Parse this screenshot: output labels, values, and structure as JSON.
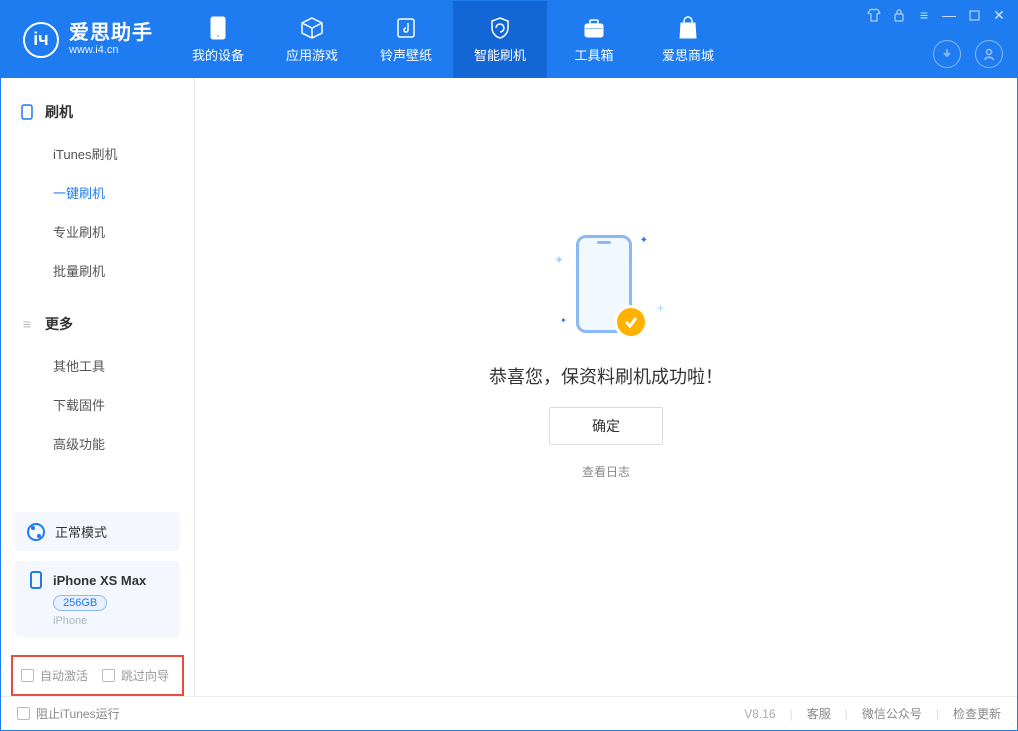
{
  "app": {
    "name": "爱思助手",
    "url": "www.i4.cn"
  },
  "nav": {
    "device": "我的设备",
    "apps": "应用游戏",
    "ringtones": "铃声壁纸",
    "flash": "智能刷机",
    "toolbox": "工具箱",
    "store": "爱思商城"
  },
  "sidebar": {
    "section_flash": "刷机",
    "items_flash": {
      "itunes": "iTunes刷机",
      "oneclick": "一键刷机",
      "pro": "专业刷机",
      "batch": "批量刷机"
    },
    "section_more": "更多",
    "items_more": {
      "other": "其他工具",
      "firmware": "下载固件",
      "advanced": "高级功能"
    },
    "mode": "正常模式",
    "device": {
      "name": "iPhone XS Max",
      "capacity": "256GB",
      "type": "iPhone"
    },
    "auto_activate": "自动激活",
    "skip_guide": "跳过向导"
  },
  "main": {
    "success": "恭喜您，保资料刷机成功啦！",
    "ok": "确定",
    "view_log": "查看日志"
  },
  "footer": {
    "block_itunes": "阻止iTunes运行",
    "version": "V8.16",
    "support": "客服",
    "wechat": "微信公众号",
    "update": "检查更新"
  }
}
